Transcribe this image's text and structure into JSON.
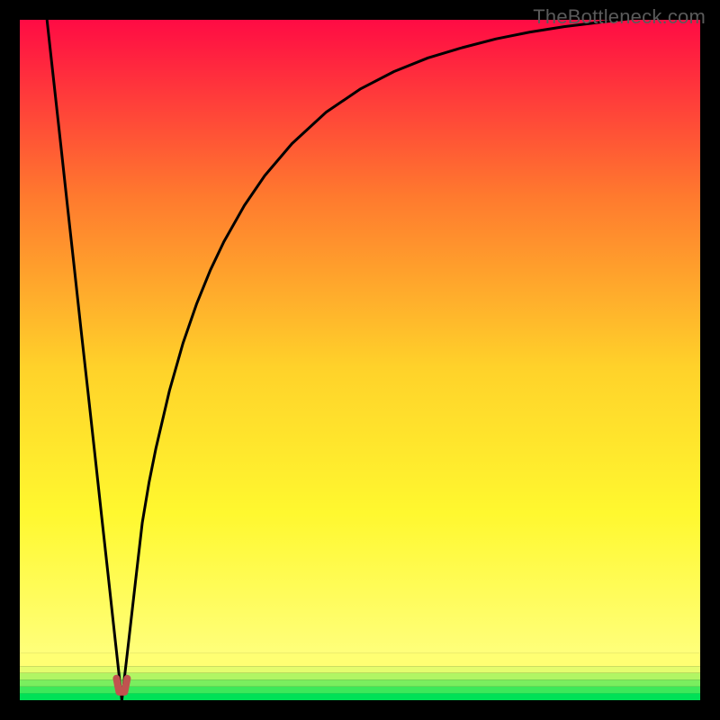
{
  "watermark": "TheBottleneck.com",
  "chart_data": {
    "type": "line",
    "title": "",
    "xlabel": "",
    "ylabel": "",
    "xlim": [
      0,
      100
    ],
    "ylim": [
      0,
      100
    ],
    "series": [
      {
        "name": "curve",
        "x": [
          4,
          5,
          6,
          7,
          8,
          9,
          10,
          11,
          12,
          13,
          14,
          15,
          16,
          17,
          18,
          19,
          20,
          22,
          24,
          26,
          28,
          30,
          33,
          36,
          40,
          45,
          50,
          55,
          60,
          65,
          70,
          75,
          80,
          85,
          90,
          95,
          100
        ],
        "y": [
          100,
          90.9,
          81.8,
          72.7,
          63.6,
          54.5,
          45.5,
          36.4,
          27.3,
          18.2,
          9.1,
          0,
          8.7,
          17.4,
          26.1,
          32.0,
          37.0,
          45.5,
          52.5,
          58.3,
          63.2,
          67.4,
          72.7,
          77.1,
          81.8,
          86.4,
          89.8,
          92.4,
          94.4,
          95.9,
          97.2,
          98.2,
          99.0,
          99.6,
          100.2,
          100.6,
          101.0
        ]
      },
      {
        "name": "marker-notch",
        "x": [
          14.2,
          14.6,
          15.0,
          15.4,
          15.8
        ],
        "y": [
          3.2,
          1.2,
          1.2,
          1.2,
          3.2
        ]
      }
    ],
    "gradient_bands": [
      {
        "y_from": 100,
        "y_to": 7,
        "type": "linear",
        "top_color": "#ff0b44",
        "bottom_color": "#11e759"
      },
      {
        "y_from": 7,
        "y_to": 5,
        "type": "solid",
        "color": "#ffff73"
      },
      {
        "y_from": 5,
        "y_to": 4,
        "type": "solid",
        "color": "#e4fc6e"
      },
      {
        "y_from": 4,
        "y_to": 3,
        "type": "solid",
        "color": "#b1f564"
      },
      {
        "y_from": 3,
        "y_to": 2,
        "type": "solid",
        "color": "#7aee5f"
      },
      {
        "y_from": 2,
        "y_to": 1,
        "type": "solid",
        "color": "#3de85a"
      },
      {
        "y_from": 1,
        "y_to": 0,
        "type": "solid",
        "color": "#00e157"
      }
    ],
    "marker": {
      "color": "#c0534f",
      "stroke_width": 8
    },
    "curve": {
      "color": "#000000",
      "stroke_width": 3
    }
  }
}
